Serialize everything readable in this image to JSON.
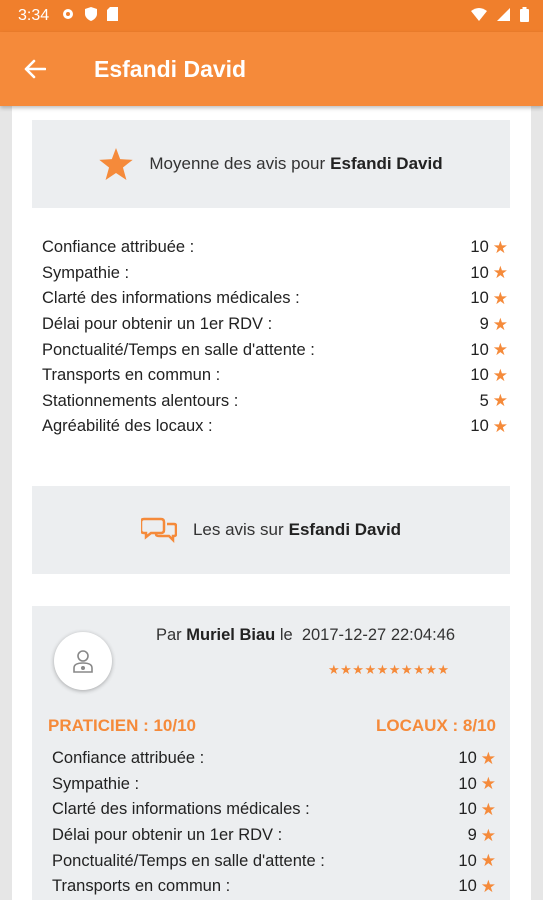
{
  "status_bar": {
    "time": "3:34"
  },
  "header": {
    "title": "Esfandi David"
  },
  "average_banner": {
    "prefix": "Moyenne des avis pour",
    "name": "Esfandi David"
  },
  "ratings": [
    {
      "label": "Confiance attribuée :",
      "value": "10"
    },
    {
      "label": "Sympathie :",
      "value": "10"
    },
    {
      "label": "Clarté des informations médicales :",
      "value": "10"
    },
    {
      "label": "Délai pour obtenir un 1er RDV :",
      "value": "9"
    },
    {
      "label": "Ponctualité/Temps en salle d'attente :",
      "value": "10"
    },
    {
      "label": "Transports en commun :",
      "value": "10"
    },
    {
      "label": "Stationnements alentours :",
      "value": "5"
    },
    {
      "label": "Agréabilité des locaux :",
      "value": "10"
    }
  ],
  "reviews_banner": {
    "prefix": "Les avis sur",
    "name": "Esfandi David"
  },
  "review": {
    "by_prefix": "Par",
    "author": "Muriel Biau",
    "date_prefix": "le",
    "date": "2017-12-27 22:04:46",
    "stars": "★★★★★★★★★★",
    "praticien": "PRATICIEN : 10/10",
    "locaux": "LOCAUX : 8/10",
    "ratings": [
      {
        "label": "Confiance attribuée :",
        "value": "10"
      },
      {
        "label": "Sympathie :",
        "value": "10"
      },
      {
        "label": "Clarté des informations médicales :",
        "value": "10"
      },
      {
        "label": "Délai pour obtenir un 1er RDV :",
        "value": "9"
      },
      {
        "label": "Ponctualité/Temps en salle d'attente :",
        "value": "10"
      },
      {
        "label": "Transports en commun :",
        "value": "10"
      }
    ]
  },
  "icons": {
    "back": "arrow-left-icon",
    "star": "star-icon",
    "chat": "chat-bubbles-icon",
    "avatar": "doctor-icon"
  },
  "colors": {
    "accent": "#f58a3a",
    "status_bar": "#f07f2c",
    "banner_bg": "#eceef0"
  }
}
